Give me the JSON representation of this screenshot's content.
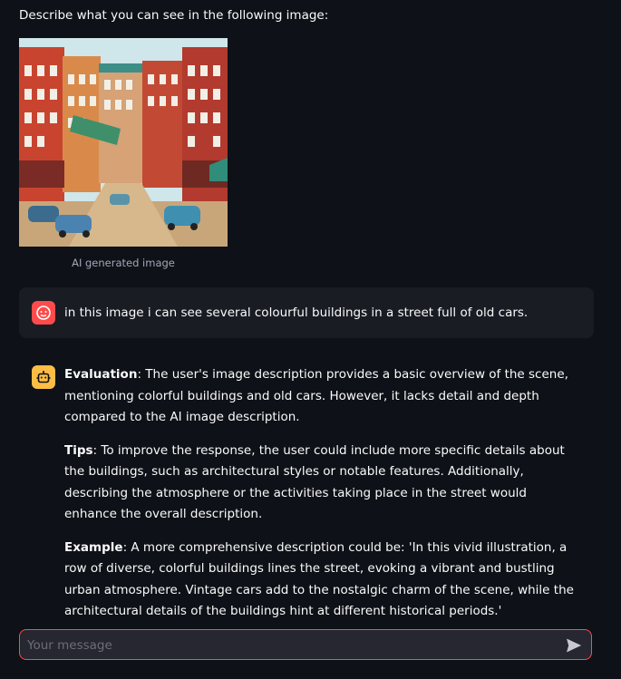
{
  "prompt": "Describe what you can see in the following image:",
  "image": {
    "caption": "AI generated image",
    "icon": "street-illustration"
  },
  "messages": {
    "user": {
      "avatar_icon": "face-icon",
      "text": "in this image i can see several colourful buildings in a street full of old cars."
    },
    "assistant": {
      "avatar_icon": "robot-icon",
      "sections": [
        {
          "label": "Evaluation",
          "text": ": The user's image description provides a basic overview of the scene, mentioning colorful buildings and old cars. However, it lacks detail and depth compared to the AI image description."
        },
        {
          "label": "Tips",
          "text": ": To improve the response, the user could include more specific details about the buildings, such as architectural styles or notable features. Additionally, describing the atmosphere or the activities taking place in the street would enhance the overall description."
        },
        {
          "label": "Example",
          "text": ": A more comprehensive description could be: 'In this vivid illustration, a row of diverse, colorful buildings lines the street, evoking a vibrant and bustling urban atmosphere. Vintage cars add to the nostalgic charm of the scene, while the architectural details of the buildings hint at different historical periods.'"
        }
      ]
    }
  },
  "chat_input": {
    "placeholder": "Your message",
    "value": "",
    "send_icon": "send-icon"
  },
  "colors": {
    "background": "#0e1117",
    "user_avatar": "#ff4b4b",
    "assistant_avatar": "#ffbd45",
    "input_border": "#ff4b4b"
  }
}
